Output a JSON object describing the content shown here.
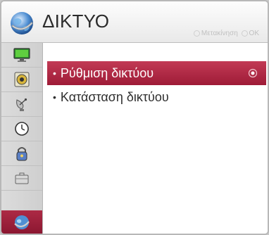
{
  "header": {
    "title": "ΔΙΚΤΥΟ",
    "hint_move": "Μετακίνηση",
    "hint_ok": "OK"
  },
  "sidebar": {
    "items": [
      {
        "icon": "picture-tv-icon",
        "active": false
      },
      {
        "icon": "audio-speaker-icon",
        "active": false
      },
      {
        "icon": "satellite-dish-icon",
        "active": false
      },
      {
        "icon": "clock-icon",
        "active": false
      },
      {
        "icon": "lock-icon",
        "active": false
      },
      {
        "icon": "options-briefcase-icon",
        "active": false
      },
      {
        "icon": "network-globe-icon",
        "active": true
      }
    ]
  },
  "menu": {
    "items": [
      {
        "label": "Ρύθμιση δικτύου",
        "selected": true
      },
      {
        "label": "Κατάσταση δικτύου",
        "selected": false
      }
    ]
  },
  "colors": {
    "accent": "#a82340",
    "background": "#ffffff",
    "sidebar": "#d4d4d4"
  }
}
